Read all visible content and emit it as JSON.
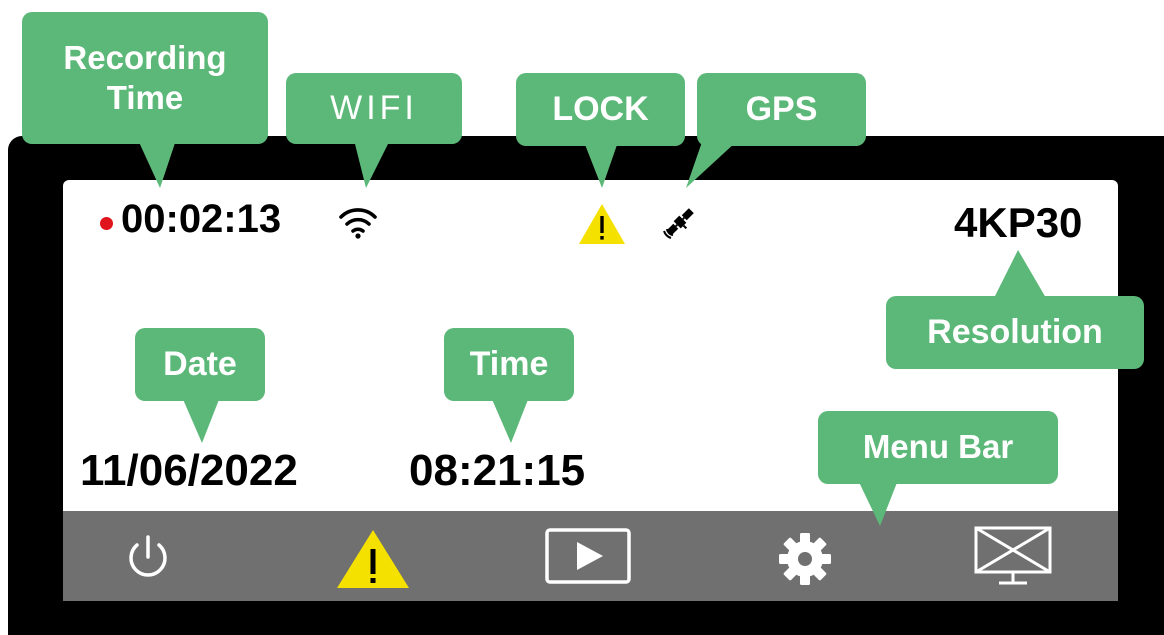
{
  "colors": {
    "callout": "#5cb878",
    "recording_dot": "#e0141c",
    "warning": "#f5e100",
    "menu_bar": "#707070",
    "device_frame": "#000000"
  },
  "screen": {
    "recording_time": "00:02:13",
    "resolution": "4KP30",
    "date": "11/06/2022",
    "time": "08:21:15",
    "status_icons": [
      "recording-dot",
      "wifi-icon",
      "lock-warning-icon",
      "gps-satellite-icon"
    ]
  },
  "menu_bar": {
    "items": [
      "power-icon",
      "warning-lock-icon",
      "playback-icon",
      "settings-gear-icon",
      "screen-off-icon"
    ]
  },
  "callouts": {
    "recording_time": "Recording\nTime",
    "wifi": "WIFI",
    "lock": "LOCK",
    "gps": "GPS",
    "resolution": "Resolution",
    "date": "Date",
    "time": "Time",
    "menu_bar": "Menu Bar"
  }
}
